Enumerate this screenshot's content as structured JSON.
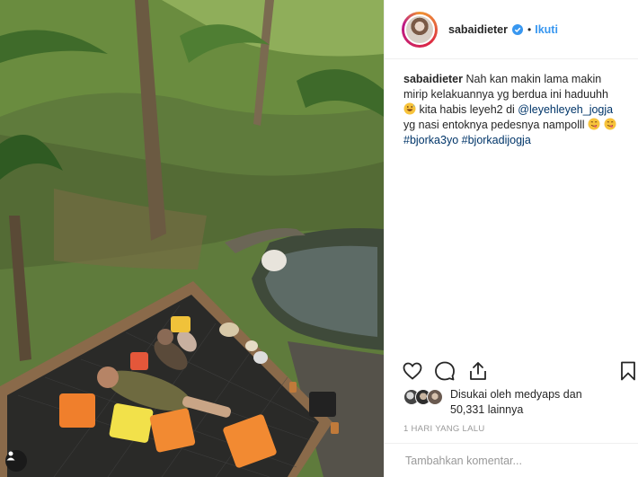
{
  "post": {
    "username": "sabaidieter",
    "verified": true,
    "follow_label": "Ikuti",
    "separator": "•"
  },
  "caption": {
    "username": "sabaidieter",
    "text_1": "Nah kan makin lama makin mirip kelakuannya yg berdua ini haduuhh",
    "text_2": "kita habis leyeh2 di",
    "mention": "@leyehleyeh_jogja",
    "text_3": "yg nasi entoknya pedesnya nampolll",
    "hashtag_1": "#bjorka3yo",
    "hashtag_2": "#bjorkadijogja"
  },
  "likes": {
    "prefix": "Disukai oleh",
    "user": "medyaps",
    "connector": "dan",
    "count": "50,331",
    "suffix": "lainnya"
  },
  "timestamp": "1 HARI YANG LALU",
  "comment": {
    "placeholder": "Tambahkan komentar..."
  },
  "icons": {
    "like": "heart-icon",
    "comment": "speech-bubble-icon",
    "share": "share-icon",
    "save": "bookmark-icon",
    "verified": "verified-badge-icon",
    "user_tag": "person-icon"
  },
  "colors": {
    "accent": "#3897f0",
    "link": "#003569",
    "muted": "#999999"
  }
}
